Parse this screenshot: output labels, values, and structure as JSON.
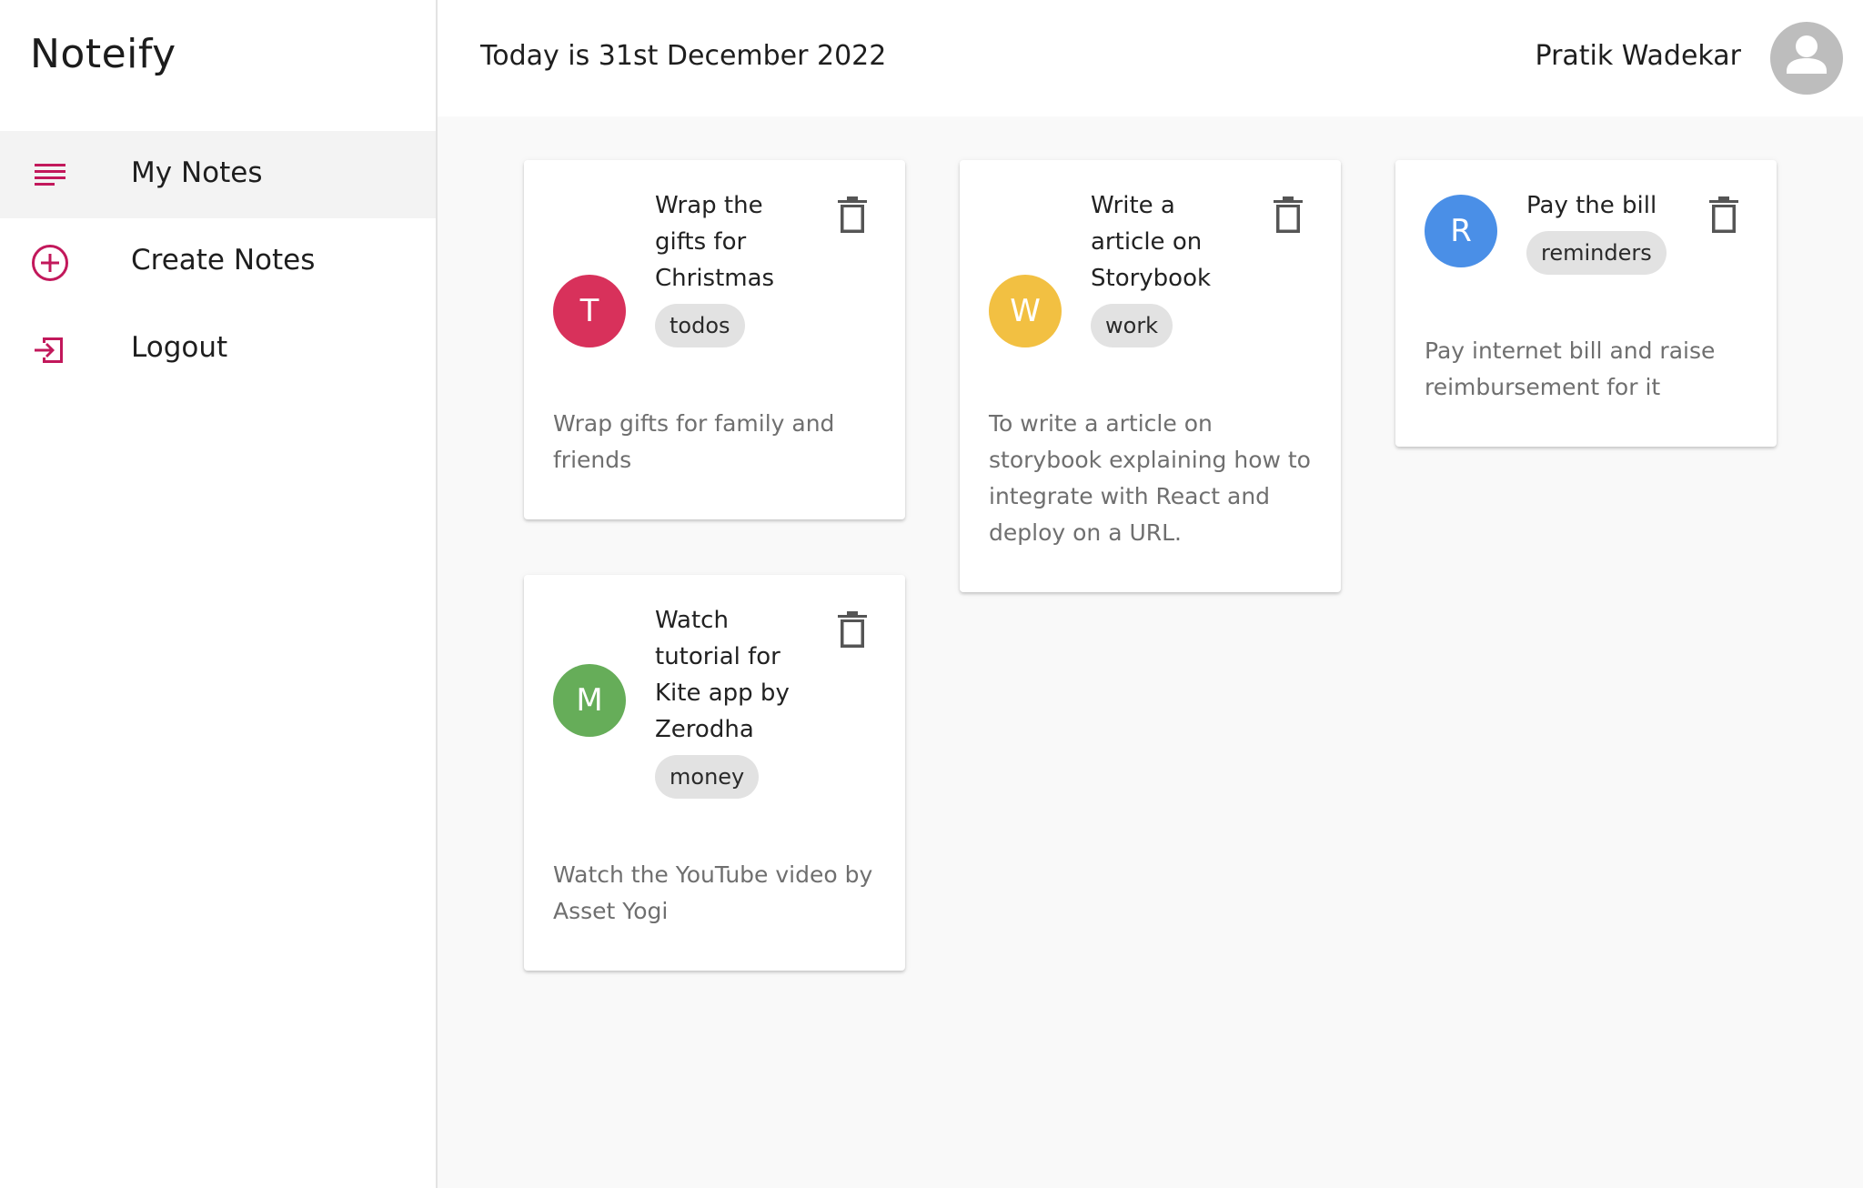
{
  "app": {
    "brand": "Noteify"
  },
  "sidebar": {
    "items": [
      {
        "label": "My Notes",
        "icon": "notes-list-icon",
        "active": true
      },
      {
        "label": "Create Notes",
        "icon": "add-circle-icon",
        "active": false
      },
      {
        "label": "Logout",
        "icon": "logout-icon",
        "active": false
      }
    ]
  },
  "header": {
    "date_text": "Today is 31st December 2022",
    "user_name": "Pratik Wadekar",
    "avatar_icon": "person-icon"
  },
  "colors": {
    "accent": "#c2185b",
    "avatar_red": "#d8315b",
    "avatar_yellow": "#f2c042",
    "avatar_blue": "#4a8fe7",
    "avatar_green": "#66ad59"
  },
  "notes": [
    {
      "initial": "T",
      "title": "Wrap the gifts for Christmas",
      "category": "todos",
      "body": "Wrap gifts for family and friends",
      "color": "#d8315b"
    },
    {
      "initial": "W",
      "title": "Write a article on Storybook",
      "category": "work",
      "body": "To write a article on storybook explaining how to integrate with React and deploy on a URL.",
      "color": "#f2c042"
    },
    {
      "initial": "R",
      "title": "Pay the bill",
      "category": "reminders",
      "body": "Pay internet bill and raise reimbursement for it",
      "color": "#4a8fe7"
    },
    {
      "initial": "M",
      "title": "Watch tutorial for Kite app by Zerodha",
      "category": "money",
      "body": "Watch the YouTube video by Asset Yogi",
      "color": "#66ad59"
    }
  ]
}
